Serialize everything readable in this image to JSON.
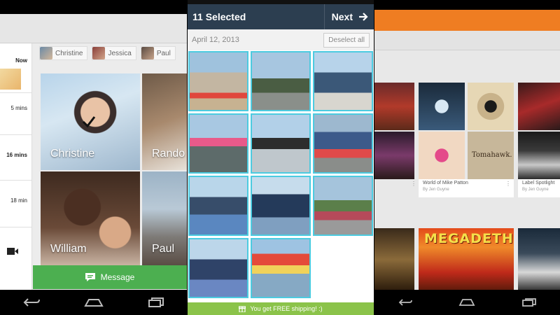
{
  "panel_people": {
    "sidebar": {
      "items": [
        "Now",
        "5 mins",
        "16 mins",
        "18 min"
      ]
    },
    "chips": [
      {
        "label": "Christine"
      },
      {
        "label": "Jessica"
      },
      {
        "label": "Paul"
      }
    ],
    "tiles": [
      {
        "name": "Christine",
        "selected": true
      },
      {
        "name": "Rando"
      },
      {
        "name": "William"
      },
      {
        "name": "Paul"
      }
    ],
    "message_button": {
      "label": "Message",
      "icon": "message-icon",
      "color": "#4caf50"
    }
  },
  "panel_photos": {
    "header": {
      "title": "11 Selected",
      "next_label": "Next",
      "color": "#2c3e50"
    },
    "date": "April 12, 2013",
    "deselect_label": "Deselect all",
    "selected_count": 11,
    "promo": {
      "text": "You get FREE shipping! :)",
      "icon": "gift-icon",
      "color": "#8bc34a"
    },
    "accent": "#4ccbe0"
  },
  "panel_music": {
    "accent": "#ef7d22",
    "cards": [
      {
        "title": "World of Mike Patton",
        "subtitle": "By Jen Guyne"
      },
      {
        "title": "Label Spotlight",
        "subtitle": "By Jen Guyne"
      }
    ],
    "album_art_text": [
      "Tomahawk.",
      "MEGADETH"
    ]
  },
  "navbar": {
    "icons": [
      "back-icon",
      "home-icon",
      "recents-icon"
    ]
  }
}
